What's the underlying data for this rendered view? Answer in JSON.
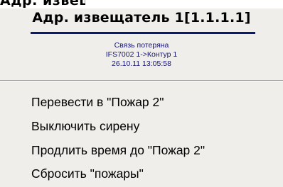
{
  "header": {
    "cut_title": "Адр. извещ"
  },
  "device": {
    "title": "Адр. извещатель 1[1.1.1.1]"
  },
  "event": {
    "status": "Связь потеряна",
    "source": "IFS7002 1->Контур 1",
    "timestamp": "26.10.11 13:05:58"
  },
  "menu": {
    "items": [
      {
        "label": "Перевести в \"Пожар 2\""
      },
      {
        "label": "Выключить сирену"
      },
      {
        "label": "Продлить время до \"Пожар 2\""
      },
      {
        "label": "Сбросить \"пожары\""
      }
    ]
  }
}
